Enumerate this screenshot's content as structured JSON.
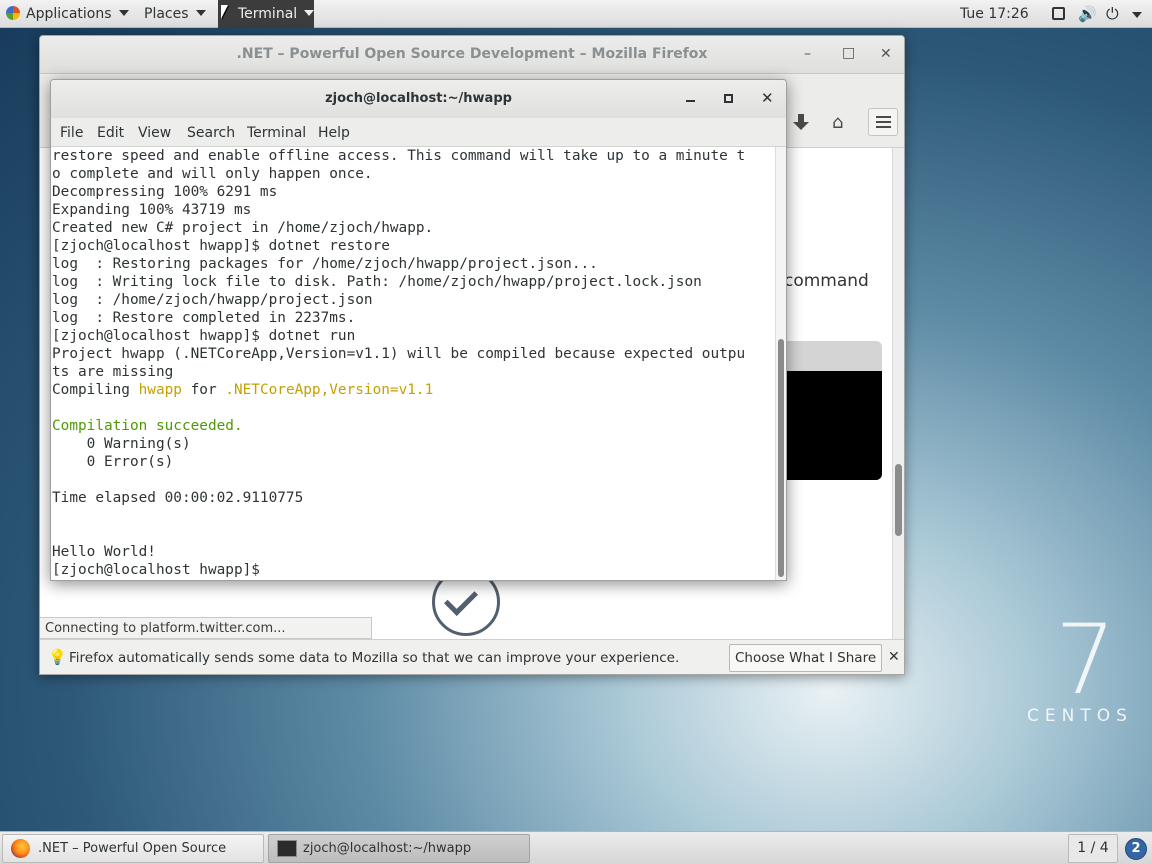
{
  "topbar": {
    "applications": "Applications",
    "places": "Places",
    "terminal": "Terminal",
    "clock": "Tue 17:26",
    "icons": [
      "screen-icon",
      "volume-icon",
      "power-icon"
    ]
  },
  "firefox": {
    "title": ".NET – Powerful Open Source Development – Mozilla Firefox",
    "page_partial_text": "command",
    "status": "Connecting to platform.twitter.com...",
    "notification": {
      "message": "Firefox automatically sends some data to Mozilla so that we can improve your experience.",
      "button": "Choose What I Share",
      "close": "✕"
    },
    "buttons": {
      "minimize": "–",
      "maximize": "□",
      "close": "✕"
    }
  },
  "terminal": {
    "title": "zjoch@localhost:~/hwapp",
    "menu": [
      "File",
      "Edit",
      "View",
      "Search",
      "Terminal",
      "Help"
    ],
    "lines": [
      "restore speed and enable offline access. This command will take up to a minute t",
      "o complete and will only happen once.",
      "Decompressing 100% 6291 ms",
      "Expanding 100% 43719 ms",
      "Created new C# project in /home/zjoch/hwapp.",
      "[zjoch@localhost hwapp]$ dotnet restore",
      "log  : Restoring packages for /home/zjoch/hwapp/project.json...",
      "log  : Writing lock file to disk. Path: /home/zjoch/hwapp/project.lock.json",
      "log  : /home/zjoch/hwapp/project.json",
      "log  : Restore completed in 2237ms.",
      "[zjoch@localhost hwapp]$ dotnet run",
      "Project hwapp (.NETCoreApp,Version=v1.1) will be compiled because expected outpu",
      "ts are missing"
    ],
    "compiling": {
      "prefix": "Compiling ",
      "project": "hwapp",
      "middle": " for ",
      "framework": ".NETCoreApp,Version=v1.1"
    },
    "success": "Compilation succeeded.",
    "warnings": "    0 Warning(s)",
    "errors": "    0 Error(s)",
    "elapsed": "Time elapsed 00:00:02.9110775",
    "hello": "Hello World!",
    "prompt": "[zjoch@localhost hwapp]$ "
  },
  "taskbar": {
    "items": [
      ".NET – Powerful Open Source Dev...",
      "zjoch@localhost:~/hwapp"
    ],
    "workspace": "1 / 4",
    "notifications": "2"
  },
  "desktop": {
    "logo_number": "7",
    "logo_word": "CENTOS"
  },
  "colors": {
    "terminal_olive": "#c4a000",
    "terminal_green": "#4e9a06",
    "workspace_badge": "#3465a4"
  }
}
